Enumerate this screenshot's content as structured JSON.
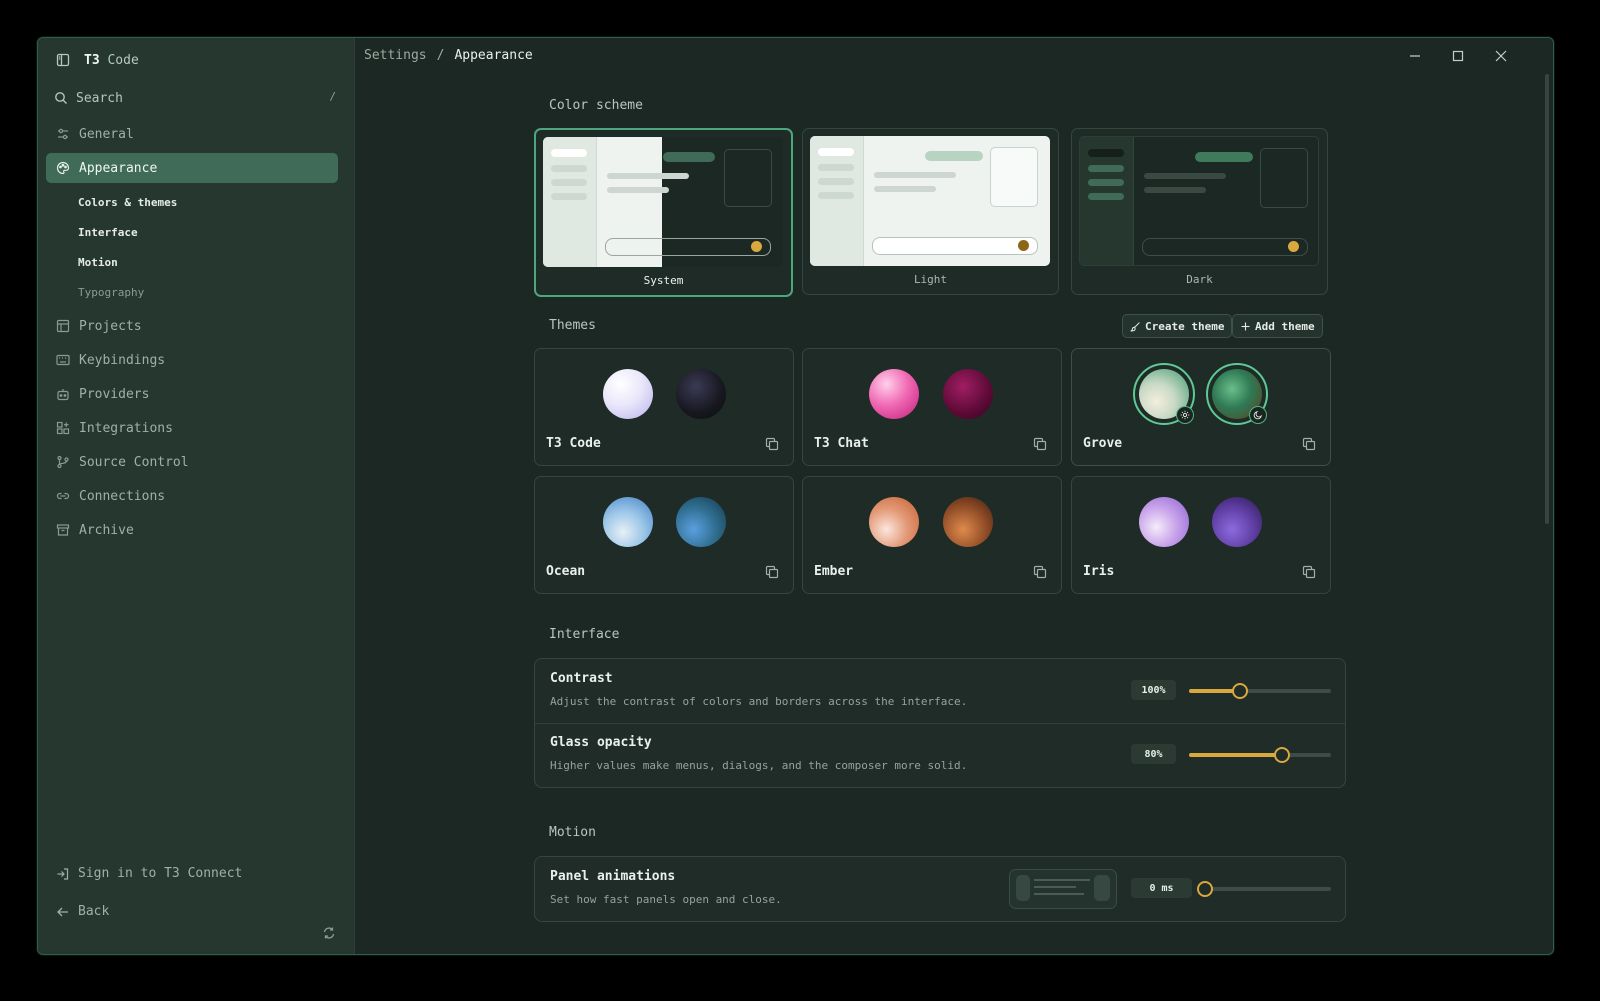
{
  "app": {
    "brand_bold": "T3",
    "brand_rest": " Code"
  },
  "sidebar": {
    "search_label": "Search",
    "search_shortcut": "/",
    "items": [
      {
        "label": "General",
        "icon": "sliders-icon"
      },
      {
        "label": "Appearance",
        "icon": "palette-icon",
        "active": true
      },
      {
        "label": "Projects",
        "icon": "layout-icon"
      },
      {
        "label": "Keybindings",
        "icon": "keyboard-icon"
      },
      {
        "label": "Providers",
        "icon": "bot-icon"
      },
      {
        "label": "Integrations",
        "icon": "grid-plus-icon"
      },
      {
        "label": "Source Control",
        "icon": "git-branch-icon"
      },
      {
        "label": "Connections",
        "icon": "link-icon"
      },
      {
        "label": "Archive",
        "icon": "archive-icon"
      }
    ],
    "subitems": [
      "Colors & themes",
      "Interface",
      "Motion",
      "Typography"
    ],
    "sign_in": "Sign in to T3 Connect",
    "back": "Back"
  },
  "breadcrumb": {
    "root": "Settings",
    "sep": "/",
    "current": "Appearance"
  },
  "color_scheme": {
    "title": "Color scheme",
    "options": [
      "System",
      "Light",
      "Dark"
    ],
    "selected": "System"
  },
  "themes": {
    "title": "Themes",
    "create_label": "Create theme",
    "add_label": "Add theme",
    "items": [
      "T3 Code",
      "T3 Chat",
      "Grove",
      "Ocean",
      "Ember",
      "Iris"
    ],
    "selected": "Grove"
  },
  "interface": {
    "title": "Interface",
    "contrast": {
      "title": "Contrast",
      "desc": "Adjust the contrast of colors and borders across the interface.",
      "value": "100%",
      "level": 0.35
    },
    "glass": {
      "title": "Glass opacity",
      "desc": "Higher values make menus, dialogs, and the composer more solid.",
      "value": "80%",
      "level": 0.65
    }
  },
  "motion": {
    "title": "Motion",
    "panel": {
      "title": "Panel animations",
      "desc": "Set how fast panels open and close.",
      "value": "0 ms",
      "level": 0.0
    }
  },
  "colors": {
    "accent": "#d9a83e",
    "selection": "#4ea680",
    "active_nav": "#3f6b58"
  }
}
